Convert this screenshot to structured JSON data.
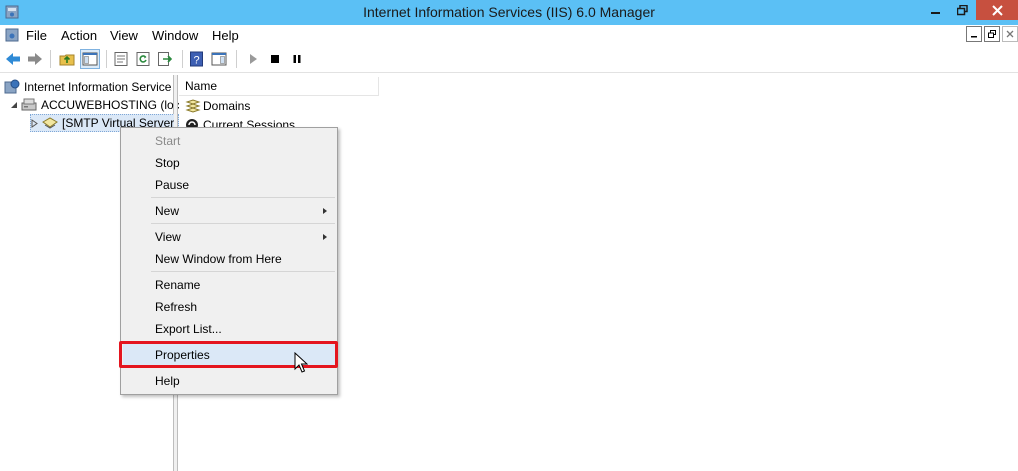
{
  "window": {
    "title": "Internet Information Services (IIS) 6.0 Manager",
    "close_color": "#c7503f",
    "titlebar_color": "#5bc0f5"
  },
  "menubar": {
    "items": [
      "File",
      "Action",
      "View",
      "Window",
      "Help"
    ]
  },
  "toolbar": {
    "buttons": [
      "back-icon",
      "forward-icon",
      "up-folder-icon",
      "show-hide-tree-icon",
      "properties-icon",
      "refresh-icon",
      "export-list-icon",
      "help-icon",
      "show-hide-action-pane-icon",
      "start-icon",
      "stop-icon",
      "pause-icon"
    ]
  },
  "tree": {
    "items": [
      {
        "label": "Internet Information Service"
      },
      {
        "label": "ACCUWEBHOSTING (loc"
      },
      {
        "label": "[SMTP Virtual Server"
      }
    ]
  },
  "list": {
    "column_header": "Name",
    "rows": [
      {
        "label": "Domains"
      },
      {
        "label": "Current Sessions"
      }
    ]
  },
  "context_menu": {
    "items": [
      {
        "label": "Start",
        "disabled": true
      },
      {
        "label": "Stop"
      },
      {
        "label": "Pause"
      },
      {
        "label": "New",
        "submenu": true
      },
      {
        "label": "View",
        "submenu": true
      },
      {
        "label": "New Window from Here"
      },
      {
        "label": "Rename"
      },
      {
        "label": "Refresh"
      },
      {
        "label": "Export List..."
      },
      {
        "label": "Properties",
        "highlighted": true
      },
      {
        "label": "Help"
      }
    ],
    "highlight_color": "#e4151f"
  }
}
